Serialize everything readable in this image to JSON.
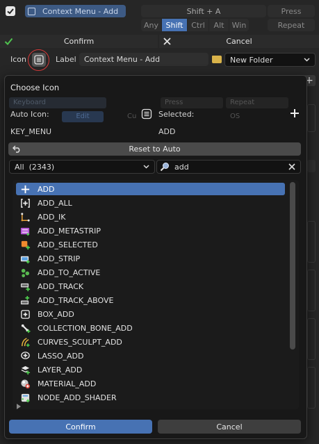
{
  "header": {
    "checkbox_checked": true,
    "keymap_name": "Context Menu - Add",
    "key_combo": "Shift + A",
    "event_type": "Press",
    "modifiers": [
      "Any",
      "Shift",
      "Ctrl",
      "Alt",
      "Win"
    ],
    "active_modifier": "Shift",
    "repeat_label": "Repeat"
  },
  "toolbar": {
    "confirm_label": "Confirm",
    "cancel_label": "Cancel"
  },
  "props": {
    "icon_label": "Icon",
    "label_label": "Label",
    "label_value": "Context Menu - Add",
    "folder_value": "New Folder"
  },
  "popup": {
    "title": "Choose Icon",
    "auto_icon_label": "Auto Icon:",
    "selected_label": "Selected:",
    "auto_icon_value": "KEY_MENU",
    "selected_value": "ADD",
    "reset_label": "Reset to Auto",
    "filter_value": "All  (2343)",
    "search_value": "add",
    "confirm_label": "Confirm",
    "cancel_label": "Cancel",
    "items": [
      {
        "name": "ADD",
        "icon": "plus-icon",
        "selected": true
      },
      {
        "name": "ADD_ALL",
        "icon": "bracket-plus-icon",
        "selected": false
      },
      {
        "name": "ADD_IK",
        "icon": "ik-chain-icon",
        "selected": false
      },
      {
        "name": "ADD_METASTRIP",
        "icon": "metastrip-icon",
        "selected": false
      },
      {
        "name": "ADD_SELECTED",
        "icon": "selected-plus-icon",
        "selected": false
      },
      {
        "name": "ADD_STRIP",
        "icon": "strip-icon",
        "selected": false
      },
      {
        "name": "ADD_TO_ACTIVE",
        "icon": "to-active-icon",
        "selected": false
      },
      {
        "name": "ADD_TRACK",
        "icon": "track-icon",
        "selected": false
      },
      {
        "name": "ADD_TRACK_ABOVE",
        "icon": "track-above-icon",
        "selected": false
      },
      {
        "name": "BOX_ADD",
        "icon": "box-add-icon",
        "selected": false
      },
      {
        "name": "COLLECTION_BONE_ADD",
        "icon": "bone-collection-icon",
        "selected": false
      },
      {
        "name": "CURVES_SCULPT_ADD",
        "icon": "curves-sculpt-icon",
        "selected": false
      },
      {
        "name": "LASSO_ADD",
        "icon": "lasso-add-icon",
        "selected": false
      },
      {
        "name": "LAYER_ADD",
        "icon": "layer-add-icon",
        "selected": false
      },
      {
        "name": "MATERIAL_ADD",
        "icon": "material-add-icon",
        "selected": false
      },
      {
        "name": "NODE_ADD_SHADER",
        "icon": "node-shader-icon",
        "selected": false
      }
    ]
  },
  "background": {
    "keyboard_label": "Keyboard",
    "press_label": "Press",
    "repeat_label": "Repeat",
    "edit_label": "Edit",
    "cu_label": "Cu",
    "os_label": "OS"
  },
  "colors": {
    "accent": "#4772b3",
    "confirm_check": "#4fc34f",
    "annotation_circle": "#d83a3a"
  }
}
